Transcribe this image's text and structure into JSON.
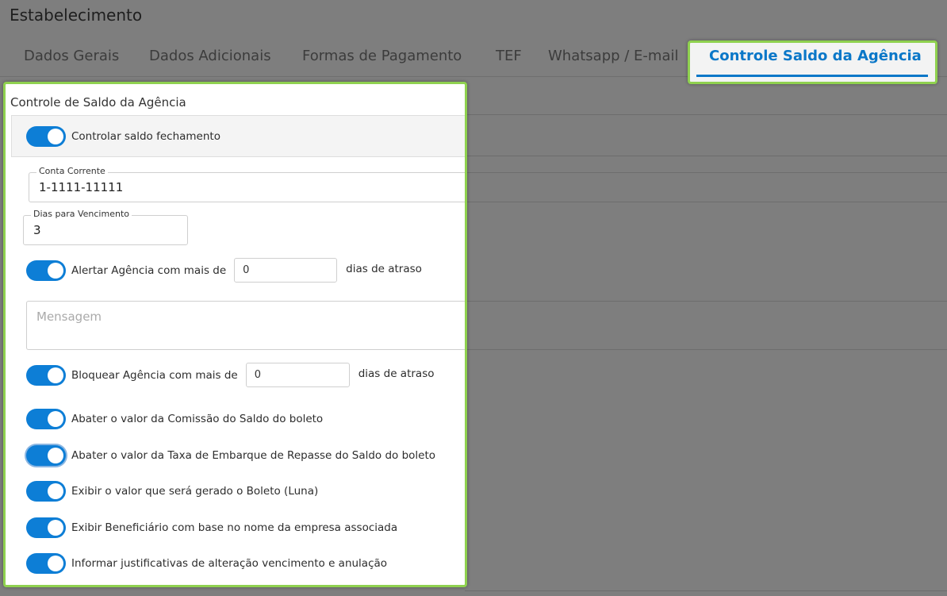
{
  "page": {
    "title": "Estabelecimento"
  },
  "tabs": [
    {
      "label": "Dados Gerais"
    },
    {
      "label": "Dados Adicionais"
    },
    {
      "label": "Formas de Pagamento"
    },
    {
      "label": "TEF"
    },
    {
      "label": "Whatsapp / E-mail"
    },
    {
      "label": "Controle Saldo da Agência",
      "active": true
    }
  ],
  "colors": {
    "accent": "#0a77c8",
    "highlight": "#8fd14f",
    "toggle_on": "#0d7ed6"
  },
  "panel": {
    "title": "Controle de Saldo da Agência",
    "controlar_saldo": {
      "label": "Controlar saldo fechamento",
      "checked": true
    },
    "conta_corrente": {
      "label": "Conta Corrente",
      "value": "1-1111-11111"
    },
    "dias_vencimento": {
      "label": "Dias para Vencimento",
      "value": "3"
    },
    "alertar": {
      "label": "Alertar Agência com mais de",
      "value": "0",
      "suffix": "dias de atraso",
      "checked": true
    },
    "mensagem": {
      "placeholder": "Mensagem"
    },
    "bloquear": {
      "label": "Bloquear Agência com mais de",
      "value": "0",
      "suffix": "dias de atraso",
      "checked": true
    },
    "toggles": [
      {
        "label": "Abater o valor da Comissão do Saldo do boleto",
        "checked": true
      },
      {
        "label": "Abater o valor da Taxa de Embarque de Repasse do Saldo do boleto",
        "checked": true
      },
      {
        "label": "Exibir o valor que será gerado o Boleto (Luna)",
        "checked": true
      },
      {
        "label": "Exibir Beneficiário com base no nome da empresa associada",
        "checked": true
      },
      {
        "label": "Informar justificativas de alteração vencimento e anulação",
        "checked": true
      }
    ]
  }
}
